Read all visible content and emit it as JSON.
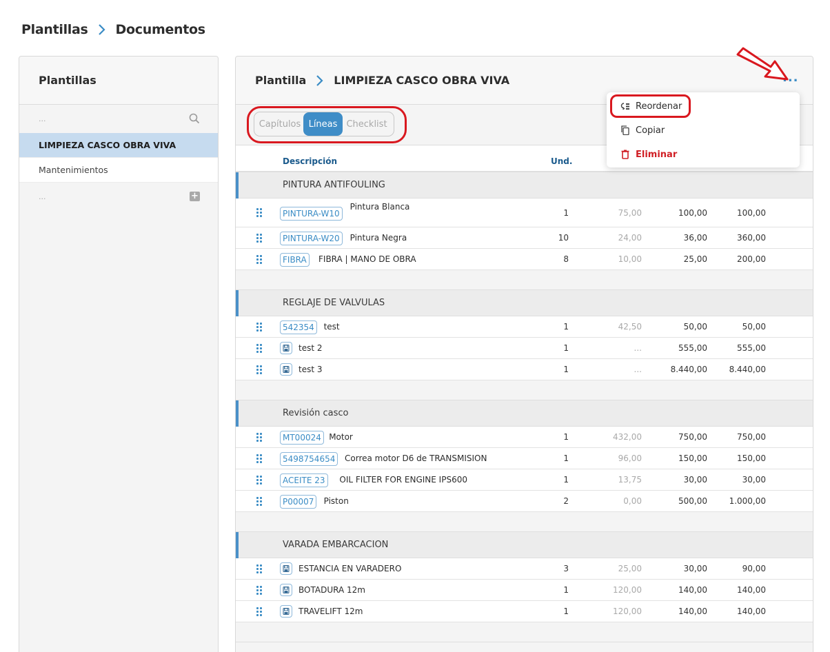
{
  "breadcrumb": {
    "root": "Plantillas",
    "current": "Documentos"
  },
  "sidebar": {
    "title": "Plantillas",
    "search_placeholder": "...",
    "items": [
      {
        "label": "LIMPIEZA CASCO OBRA VIVA",
        "selected": true
      },
      {
        "label": "Mantenimientos",
        "selected": false
      }
    ],
    "add_placeholder": "..."
  },
  "header": {
    "crumb_root": "Plantilla",
    "crumb_current": "LIMPIEZA CASCO OBRA VIVA"
  },
  "tabs": [
    {
      "label": "Capítulos",
      "active": false
    },
    {
      "label": "Líneas",
      "active": true
    },
    {
      "label": "Checklist",
      "active": false
    }
  ],
  "columns": {
    "description": "Descripción",
    "unit": "Und."
  },
  "menu": {
    "reorder": "Reordenar",
    "copy": "Copiar",
    "delete": "Eliminar"
  },
  "chapters": [
    {
      "title": "PINTURA ANTIFOULING",
      "lines": [
        {
          "code": "PINTURA-W10",
          "desc": "Pintura Blanca",
          "und": "1",
          "cost": "75,00",
          "price": "100,00",
          "total": "100,00"
        },
        {
          "code": "PINTURA-W20",
          "desc": "Pintura Negra",
          "und": "10",
          "cost": "24,00",
          "price": "36,00",
          "total": "360,00"
        },
        {
          "code": "FIBRA",
          "desc": "FIBRA | MANO DE OBRA",
          "und": "8",
          "cost": "10,00",
          "price": "25,00",
          "total": "200,00"
        }
      ]
    },
    {
      "title": "REGLAJE DE VALVULAS",
      "lines": [
        {
          "code": "542354",
          "desc": "test",
          "und": "1",
          "cost": "42,50",
          "price": "50,00",
          "total": "50,00"
        },
        {
          "code": "",
          "desc": "test 2",
          "und": "1",
          "cost": "...",
          "price": "555,00",
          "total": "555,00"
        },
        {
          "code": "",
          "desc": "test 3",
          "und": "1",
          "cost": "...",
          "price": "8.440,00",
          "total": "8.440,00"
        }
      ]
    },
    {
      "title": "Revisión casco",
      "lines": [
        {
          "code": "MT00024",
          "desc": "Motor",
          "und": "1",
          "cost": "432,00",
          "price": "750,00",
          "total": "750,00"
        },
        {
          "code": "5498754654",
          "desc": "Correa motor D6 de TRANSMISION",
          "und": "1",
          "cost": "96,00",
          "price": "150,00",
          "total": "150,00"
        },
        {
          "code": "ACEITE 23",
          "desc": "OIL FILTER FOR ENGINE IPS600",
          "und": "1",
          "cost": "13,75",
          "price": "30,00",
          "total": "30,00"
        },
        {
          "code": "P00007",
          "desc": "Piston",
          "und": "2",
          "cost": "0,00",
          "price": "500,00",
          "total": "1.000,00"
        }
      ]
    },
    {
      "title": "VARADA EMBARCACION",
      "lines": [
        {
          "code": "",
          "desc": "ESTANCIA EN VARADERO",
          "und": "3",
          "cost": "25,00",
          "price": "30,00",
          "total": "90,00"
        },
        {
          "code": "",
          "desc": "BOTADURA 12m",
          "und": "1",
          "cost": "120,00",
          "price": "140,00",
          "total": "140,00"
        },
        {
          "code": "",
          "desc": "TRAVELIFT 12m",
          "und": "1",
          "cost": "120,00",
          "price": "140,00",
          "total": "140,00"
        }
      ]
    }
  ],
  "colors": {
    "accent": "#3f8dc7",
    "annotation": "#d9181f",
    "danger": "#d01e24"
  }
}
